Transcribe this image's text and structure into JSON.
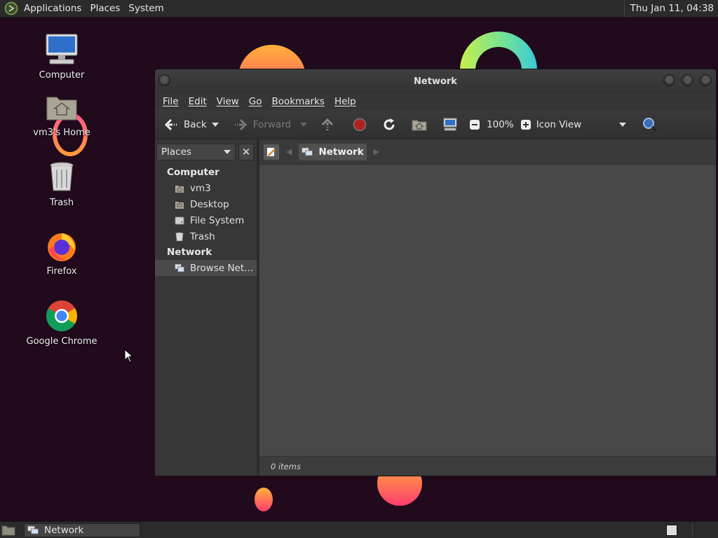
{
  "top_panel": {
    "menus": [
      "Applications",
      "Places",
      "System"
    ],
    "clock": "Thu Jan 11, 04:38"
  },
  "desktop_icons": [
    {
      "label": "Computer",
      "icon": "computer-icon"
    },
    {
      "label": "vm3's Home",
      "icon": "home-folder-icon"
    },
    {
      "label": "Trash",
      "icon": "trash-icon"
    },
    {
      "label": "Firefox",
      "icon": "firefox-icon"
    },
    {
      "label": "Google Chrome",
      "icon": "chrome-icon"
    }
  ],
  "window": {
    "title": "Network",
    "menubar": [
      "File",
      "Edit",
      "View",
      "Go",
      "Bookmarks",
      "Help"
    ],
    "toolbar": {
      "back_label": "Back",
      "forward_label": "Forward",
      "zoom_level": "100%",
      "view_mode": "Icon View"
    },
    "sidebar": {
      "selector_label": "Places",
      "sections": [
        {
          "title": "Computer",
          "items": [
            {
              "label": "vm3",
              "icon": "home-icon"
            },
            {
              "label": "Desktop",
              "icon": "desktop-folder-icon"
            },
            {
              "label": "File System",
              "icon": "drive-icon"
            },
            {
              "label": "Trash",
              "icon": "trash-icon"
            }
          ]
        },
        {
          "title": "Network",
          "items": [
            {
              "label": "Browse Net…",
              "icon": "network-icon",
              "selected": true
            }
          ]
        }
      ]
    },
    "path": {
      "current": "Network"
    },
    "status": "0 items"
  },
  "bottom_panel": {
    "task_label": "Network"
  },
  "colors": {
    "wallpaper": "#200a1c",
    "panel": "#2b2b2b",
    "window_bg": "#3c3c3c"
  }
}
